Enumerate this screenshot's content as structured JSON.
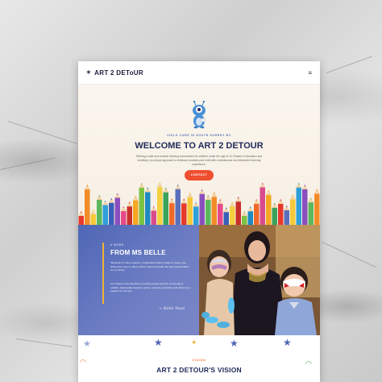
{
  "nav": {
    "brand": "ART 2 DEToUR",
    "brand_icon": "star-icon",
    "menu_icon": "hamburger-menu-icon",
    "menu_glyph": "≡"
  },
  "hero": {
    "tagline": "CHILD CARE IN SOUTH SURREY BC",
    "title": "WELCOME TO ART 2 DETOUR",
    "text": "Offering a safe and creative learning environment for children under the age of 10. Rooted in education and creativity, my unique approach to childcare provides your child with a wholesome and interactive learning experience.",
    "cta_label": "CONTACT",
    "cta_color": "#ef4f2f",
    "mascot_icon": "blue-monster-mascot-icon"
  },
  "about": {
    "kicker": "A WORD",
    "title": "FROM MS BELLE",
    "p1": "\"Because I'm also a parent, I understand what it means to leave your child in the care of others which I want to provide the best opportunities for my family.",
    "p2": "Art 2 Detour was founded to provide parents and the community a reliable, high-quality daycare service rooted in education and driven by a passion for the arts.",
    "signature": "~ Belle Yuan",
    "panel_color": "#5a6fbb",
    "accent_color": "#f2b233"
  },
  "vision": {
    "kicker": "VISION",
    "title": "ART 2 DETOUR'S VISION"
  }
}
